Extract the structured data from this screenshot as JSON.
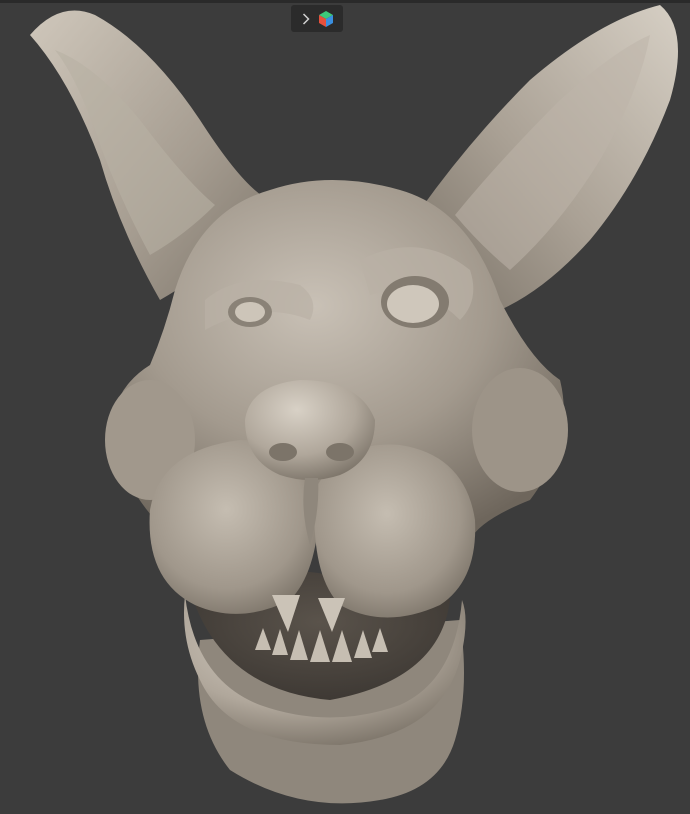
{
  "viewport": {
    "background": "#3c3c3c"
  },
  "toolbar": {
    "background": "#2b2b2b",
    "icons": [
      "chevron-right-icon",
      "app-cube-icon"
    ],
    "cube_colors": [
      "#e6503c",
      "#3cc87a",
      "#3a8fe0"
    ]
  },
  "model": {
    "description_icon": "sculpt-model",
    "surface_color": "#a39a8e"
  }
}
